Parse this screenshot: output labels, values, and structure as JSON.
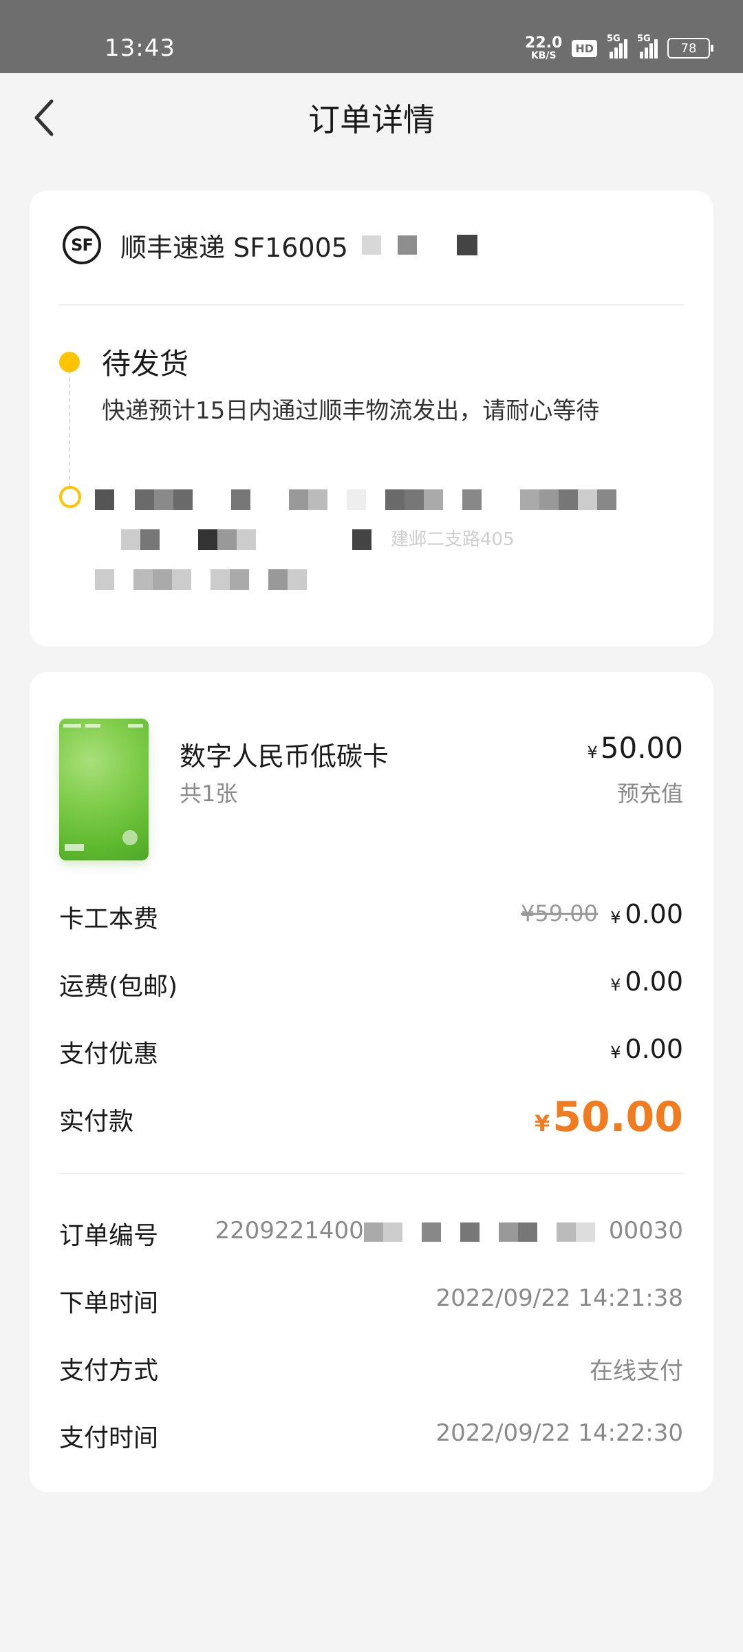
{
  "status_bar": {
    "time": "13:43",
    "net_speed_value": "22.0",
    "net_speed_unit": "KB/S",
    "hd_label": "HD",
    "signal1_label": "5G",
    "signal2_label": "5G",
    "battery": "78"
  },
  "nav": {
    "title": "订单详情",
    "back_icon": "chevron-left-icon"
  },
  "shipping": {
    "courier_logo_text": "SF",
    "courier_text": "顺丰速递 SF16005",
    "status_title": "待发货",
    "status_desc": "快递预计15日内通过顺丰物流发出，请耐心等待",
    "address_line_partial": "建邺二支路405"
  },
  "product": {
    "name": "数字人民币低碳卡",
    "qty": "共1张",
    "currency": "¥",
    "price": "50.00",
    "tag": "预充值"
  },
  "fees": {
    "card_fee_label": "卡工本费",
    "card_fee_original": "¥59.00",
    "card_fee_value": "0.00",
    "shipping_label": "运费(包邮)",
    "shipping_value": "0.00",
    "discount_label": "支付优惠",
    "discount_value": "0.00",
    "total_label": "实付款",
    "total_value": "50.00",
    "currency": "¥"
  },
  "order_info": {
    "order_no_label": "订单编号",
    "order_no_prefix": "2209221400",
    "order_no_suffix": "00030",
    "order_time_label": "下单时间",
    "order_time": "2022/09/22 14:21:38",
    "pay_method_label": "支付方式",
    "pay_method": "在线支付",
    "pay_time_label": "支付时间",
    "pay_time": "2022/09/22 14:22:30"
  },
  "colors": {
    "accent_yellow": "#ffc400",
    "total_orange": "#f07c1f",
    "status_bar_bg": "#6e6e6e",
    "page_bg": "#f4f4f4"
  }
}
